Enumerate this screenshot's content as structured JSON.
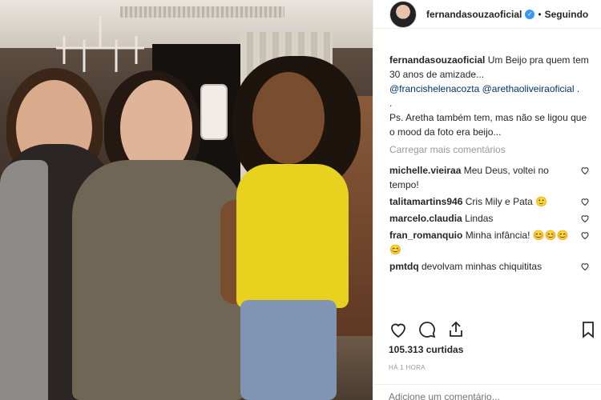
{
  "header": {
    "username": "fernandasouzaoficial",
    "separator": "•",
    "follow_status": "Seguindo"
  },
  "caption": {
    "username": "fernandasouzaoficial",
    "text_1": "Um Beijo pra quem tem 30 anos de amizade...",
    "mention_1": "@francishelenacozta",
    "mention_2": "@arethaoliveiraoficial",
    "text_2": ".",
    "text_3": ".",
    "text_4": "Ps. Aretha também tem, mas não se ligou que o mood da foto era beijo..."
  },
  "load_more": "Carregar mais comentários",
  "comments": [
    {
      "user": "michelle.vieiraa",
      "text": "Meu Deus, voltei no tempo!"
    },
    {
      "user": "talitamartins946",
      "text": "Cris Mily e Pata 🙂"
    },
    {
      "user": "marcelo.claudia",
      "text": "Lindas"
    },
    {
      "user": "fran_romanquio",
      "text": "Minha infância! 😊😊😊 😊"
    },
    {
      "user": "pmtdq",
      "text": "devolvam minhas chiquititas"
    }
  ],
  "likes": "105.313 curtidas",
  "timestamp": "HÁ 1 HORA",
  "add_comment_placeholder": "Adicione um comentário...",
  "colors": {
    "verified": "#3897f0",
    "mention": "#003569",
    "muted": "#999999"
  }
}
